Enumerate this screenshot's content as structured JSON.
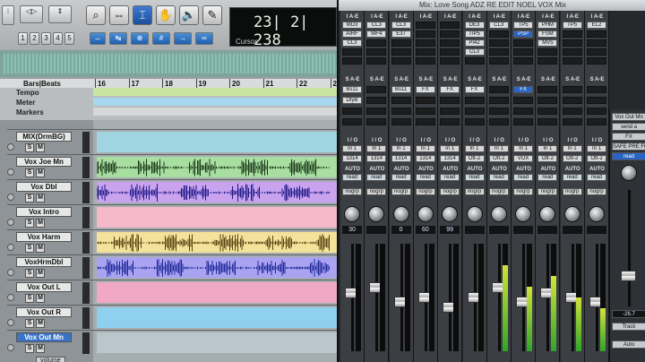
{
  "edit": {
    "counter_value": "23| 2| 238",
    "counter_label": "Cursor",
    "grid_buttons": [
      "1",
      "2",
      "3",
      "4",
      "5"
    ],
    "ruler_title": "Bars|Beats",
    "bar_numbers": [
      "16",
      "17",
      "18",
      "19",
      "20",
      "21",
      "22",
      "23",
      "24",
      "25"
    ],
    "rulers": {
      "tempo": "Tempo",
      "meter": "Meter",
      "markers": "Markers"
    },
    "tracks": [
      {
        "name": "MIX(DrmBG)",
        "color": "#9fd4e0",
        "wave": false,
        "selected": false
      },
      {
        "name": "Vox Joe Mn",
        "color": "#a8dfa0",
        "wave": true,
        "wave_color": "#1d3b1c",
        "selected": false
      },
      {
        "name": "Vox Dbl",
        "color": "#c9a3ee",
        "wave": true,
        "wave_color": "#1e1a8a",
        "selected": false
      },
      {
        "name": "Vox Intro",
        "color": "#f4b8c8",
        "wave": false,
        "selected": false
      },
      {
        "name": "Vox Harm",
        "color": "#f3e29a",
        "wave": true,
        "wave_color": "#5a4210",
        "selected": false
      },
      {
        "name": "VoxHrmDbl",
        "color": "#a9a3f1",
        "wave": true,
        "wave_color": "#1f2a9a",
        "selected": false
      },
      {
        "name": "Vox Out L",
        "color": "#f0a8c4",
        "wave": false,
        "selected": false
      },
      {
        "name": "Vox Out R",
        "color": "#8fd0ee",
        "wave": false,
        "selected": false
      },
      {
        "name": "Vox Out Mn",
        "color": "#b9c7cc",
        "wave": false,
        "selected": true
      }
    ],
    "solo_label": "S",
    "mute_label": "M",
    "volume_label": "volume"
  },
  "mix": {
    "title": "Mix: Love Song ADZ RE EDIT NOEL VOX Mix",
    "section_labels": {
      "inserts_a": "I A-E",
      "sends_a": "S A-E",
      "io": "I / O",
      "auto": "AUTO",
      "read": "read",
      "group": "nogrp"
    },
    "strips": [
      {
        "inserts": [
          "MD3",
          "AIRF",
          "CL3"
        ],
        "sends": [
          "Bs11",
          "DlyB"
        ],
        "input": "In 1",
        "output": "1314",
        "value": "30",
        "fader": 0.55,
        "meter": 0.0
      },
      {
        "inserts": [
          "CL3",
          "MF4"
        ],
        "sends": [],
        "input": "In 1",
        "output": "1314",
        "value": "",
        "fader": 0.6,
        "meter": 0.0
      },
      {
        "inserts": [
          "CL3",
          "E37"
        ],
        "sends": [
          "Bs11"
        ],
        "input": "In 1",
        "output": "1314",
        "value": "0",
        "fader": 0.45,
        "meter": 0.0
      },
      {
        "inserts": [],
        "sends": [
          "FX"
        ],
        "input": "In 1",
        "output": "1314",
        "value": "60",
        "fader": 0.5,
        "meter": 0.0
      },
      {
        "inserts": [],
        "sends": [
          "FX"
        ],
        "input": "In 1",
        "output": "1314",
        "value": "99",
        "fader": 0.4,
        "meter": 0.0
      },
      {
        "inserts": [
          "DE3",
          "TrP5",
          "PI42",
          "CL3"
        ],
        "sends": [
          "FX"
        ],
        "input": "In 1",
        "output": "Ott-2",
        "value": "",
        "fader": 0.5,
        "meter": 0.0
      },
      {
        "inserts": [
          "CL3"
        ],
        "sends": [],
        "input": "In 1",
        "output": "Ott-2",
        "value": "",
        "fader": 0.6,
        "meter": 0.8
      },
      {
        "inserts": [
          "TP5",
          "PSP"
        ],
        "sends": [
          "FX"
        ],
        "input": "In 1",
        "output": "VOX",
        "value": "",
        "fader": 0.45,
        "meter": 0.6
      },
      {
        "inserts": [
          "PHM",
          "FSM",
          "MV5"
        ],
        "sends": [],
        "input": "In 1",
        "output": "Ott-2",
        "value": "",
        "fader": 0.55,
        "meter": 0.7
      },
      {
        "inserts": [
          "TP5"
        ],
        "sends": [],
        "input": "In 1",
        "output": "Ott-2",
        "value": "",
        "fader": 0.5,
        "meter": 0.5
      },
      {
        "inserts": [
          "EL2"
        ],
        "sends": [],
        "input": "In 1",
        "output": "Ott-2",
        "value": "",
        "fader": 0.45,
        "meter": 0.4
      }
    ],
    "send_window": {
      "name": "Vox Out Mn",
      "send": "send a",
      "fx": "FX",
      "mode": "SAFE PRE FMP",
      "auto": "read",
      "value": "-26.7",
      "track": "Track",
      "auto_btn": "Auto"
    }
  }
}
